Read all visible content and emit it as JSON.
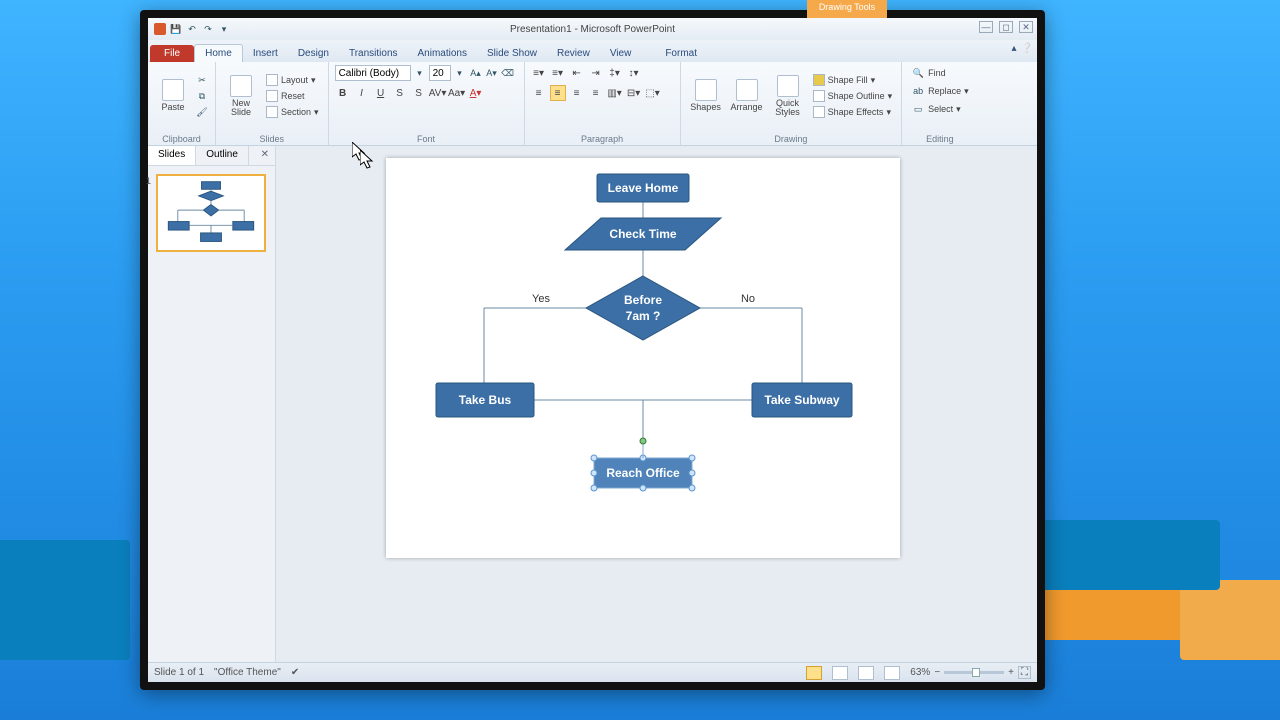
{
  "window": {
    "title": "Presentation1 - Microsoft PowerPoint",
    "context_tab_title": "Drawing Tools"
  },
  "tabs": {
    "file": "File",
    "home": "Home",
    "insert": "Insert",
    "design": "Design",
    "transitions": "Transitions",
    "animations": "Animations",
    "slideshow": "Slide Show",
    "review": "Review",
    "view": "View",
    "format": "Format"
  },
  "ribbon": {
    "clipboard": {
      "label": "Clipboard",
      "paste": "Paste"
    },
    "slides": {
      "label": "Slides",
      "new": "New\nSlide",
      "layout": "Layout",
      "reset": "Reset",
      "section": "Section"
    },
    "font": {
      "label": "Font",
      "name": "Calibri (Body)",
      "size": "20"
    },
    "paragraph": {
      "label": "Paragraph"
    },
    "drawing": {
      "label": "Drawing",
      "shapes": "Shapes",
      "arrange": "Arrange",
      "quick": "Quick\nStyles",
      "fill": "Shape Fill",
      "outline": "Shape Outline",
      "effects": "Shape Effects"
    },
    "editing": {
      "label": "Editing",
      "find": "Find",
      "replace": "Replace",
      "select": "Select"
    }
  },
  "sidebar": {
    "slides": "Slides",
    "outline": "Outline",
    "num": "1"
  },
  "flowchart": {
    "leave_home": "Leave Home",
    "check_time": "Check Time",
    "decision_l1": "Before",
    "decision_l2": "7am ?",
    "yes": "Yes",
    "no": "No",
    "take_bus": "Take Bus",
    "take_subway": "Take Subway",
    "reach_office": "Reach Office"
  },
  "status": {
    "slide": "Slide 1 of 1",
    "theme": "\"Office Theme\"",
    "zoom": "63%"
  }
}
